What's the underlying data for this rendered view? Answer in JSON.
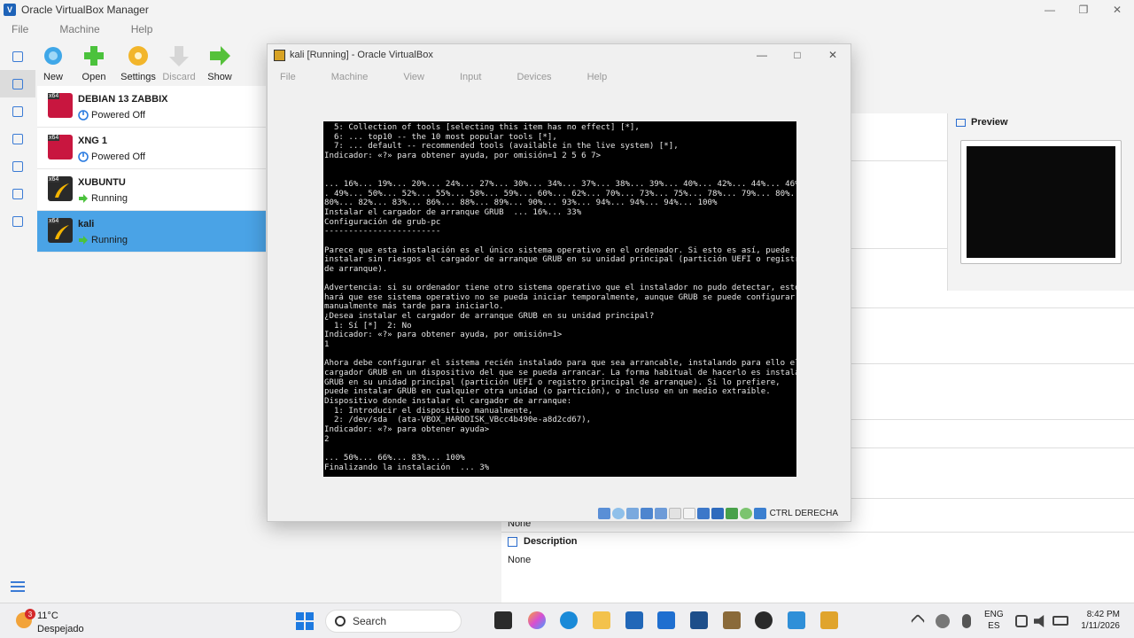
{
  "manager": {
    "title": "Oracle VirtualBox Manager",
    "menu": [
      "File",
      "Machine",
      "Help"
    ],
    "toolbar": [
      {
        "label": "New",
        "icon": "new-vm-icon",
        "enabled": true
      },
      {
        "label": "Open",
        "icon": "open-add-icon",
        "enabled": true
      },
      {
        "label": "Settings",
        "icon": "settings-gear-icon",
        "enabled": true
      },
      {
        "label": "Discard",
        "icon": "discard-arrow-icon",
        "enabled": false
      },
      {
        "label": "Show",
        "icon": "show-arrow-icon",
        "enabled": true
      }
    ],
    "vms": [
      {
        "name": "DEBIAN 13 ZABBIX",
        "state": "Powered Off",
        "os_badge": "x64",
        "os_icon": "debian-icon",
        "state_icon": "powered-off-icon",
        "selected": false
      },
      {
        "name": "XNG 1",
        "state": "Powered Off",
        "os_badge": "x64",
        "os_icon": "debian-icon",
        "state_icon": "powered-off-icon",
        "selected": false
      },
      {
        "name": "XUBUNTU",
        "state": "Running",
        "os_badge": "x64",
        "os_icon": "linux-icon",
        "state_icon": "running-arrow-icon",
        "selected": false
      },
      {
        "name": "kali",
        "state": "Running",
        "os_badge": "x64",
        "os_icon": "linux-icon",
        "state_icon": "running-arrow-icon",
        "selected": true
      }
    ],
    "preview_label": "Preview",
    "details_none": "None",
    "description_label": "Description",
    "description_value": "None"
  },
  "vm_window": {
    "title": "kali [Running] - Oracle VirtualBox",
    "menu": [
      "File",
      "Machine",
      "View",
      "Input",
      "Devices",
      "Help"
    ],
    "terminal_lines": [
      "  5: Collection of tools [selecting this item has no effect] [*],",
      "  6: ... top10 -- the 10 most popular tools [*],",
      "  7: ... default -- recommended tools (available in the live system) [*],",
      "Indicador: «?» para obtener ayuda, por omisión=1 2 5 6 7>",
      "",
      "",
      "... 16%... 19%... 20%... 24%... 27%... 30%... 34%... 37%... 38%... 39%... 40%... 42%... 44%... 46%..",
      ". 49%... 50%... 52%... 55%... 58%... 59%... 60%... 62%... 70%... 73%... 75%... 78%... 79%... 80%...",
      "80%... 82%... 83%... 86%... 88%... 89%... 90%... 93%... 94%... 94%... 94%... 100%",
      "Instalar el cargador de arranque GRUB  ... 16%... 33%",
      "Configuración de grub-pc",
      "------------------------",
      "",
      "Parece que esta instalación es el único sistema operativo en el ordenador. Si esto es así, puede",
      "instalar sin riesgos el cargador de arranque GRUB en su unidad principal (partición UEFI o registro",
      "de arranque).",
      "",
      "Advertencia: si su ordenador tiene otro sistema operativo que el instalador no pudo detectar, esto",
      "hará que ese sistema operativo no se pueda iniciar temporalmente, aunque GRUB se puede configurar",
      "manualmente más tarde para iniciarlo.",
      "¿Desea instalar el cargador de arranque GRUB en su unidad principal?",
      "  1: Sí [*]  2: No",
      "Indicador: «?» para obtener ayuda, por omisión=1>",
      "1",
      "",
      "Ahora debe configurar el sistema recién instalado para que sea arrancable, instalando para ello el",
      "cargador GRUB en un dispositivo del que se pueda arrancar. La forma habitual de hacerlo es instalar",
      "GRUB en su unidad principal (partición UEFI o registro principal de arranque). Si lo prefiere,",
      "puede instalar GRUB en cualquier otra unidad (o partición), o incluso en un medio extraíble.",
      "Dispositivo donde instalar el cargador de arranque:",
      "  1: Introducir el dispositivo manualmente,",
      "  2: /dev/sda  (ata-VBOX_HARDDISK_VBcc4b490e-a8d2cd67),",
      "Indicador: «?» para obtener ayuda>",
      "2",
      "",
      "... 50%... 66%... 83%... 100%",
      "Finalizando la instalación  ... 3%"
    ],
    "host_key": "CTRL DERECHA"
  },
  "taskbar": {
    "weather_temp": "11°C",
    "weather_cond": "Despejado",
    "weather_badge": "3",
    "search_placeholder": "Search",
    "lang_top": "ENG",
    "lang_bottom": "ES",
    "time": "8:42 PM",
    "date": "1/11/2026"
  }
}
